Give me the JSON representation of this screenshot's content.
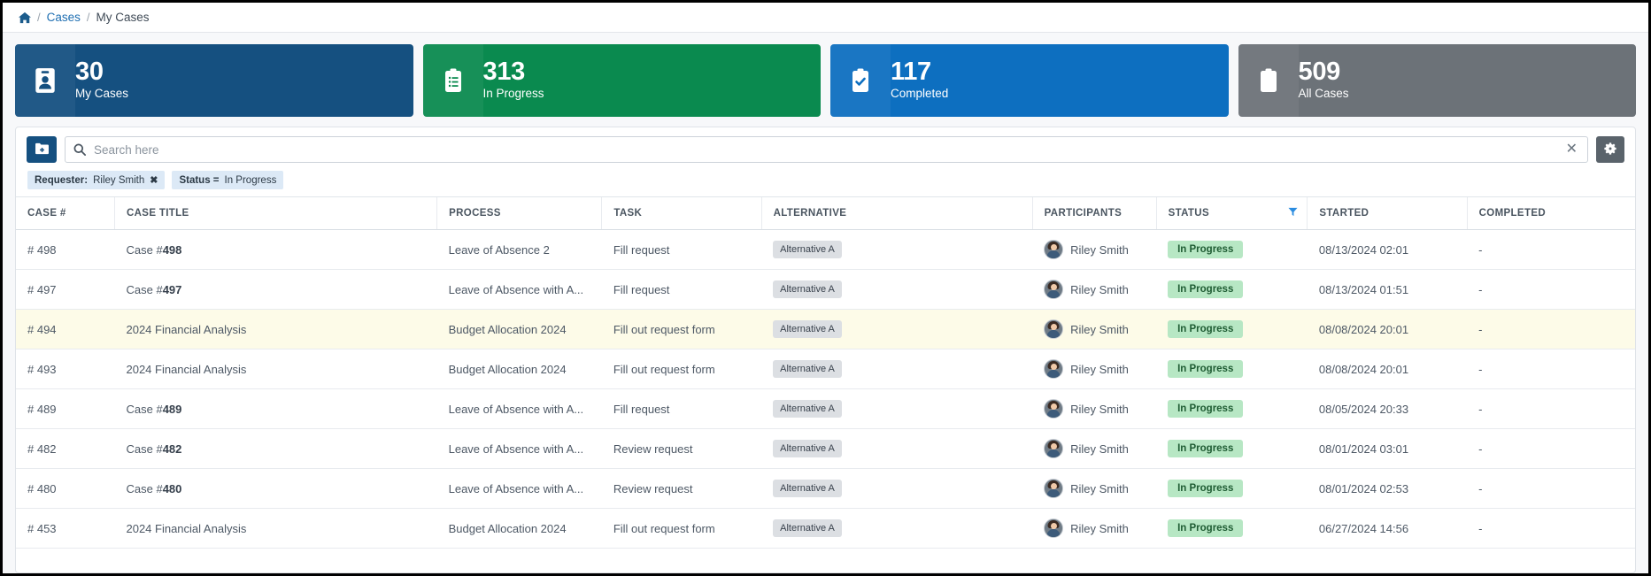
{
  "breadcrumb": {
    "home_icon": "home-icon",
    "separator": "/",
    "items": [
      {
        "label": "Cases",
        "link": true
      },
      {
        "label": "My Cases",
        "link": false
      }
    ]
  },
  "stat_cards": [
    {
      "value": "30",
      "label": "My Cases",
      "color": "#155080",
      "icon": "id-card-icon"
    },
    {
      "value": "313",
      "label": "In Progress",
      "color": "#0a8a4f",
      "icon": "clipboard-list-icon"
    },
    {
      "value": "117",
      "label": "Completed",
      "color": "#0d6fc0",
      "icon": "clipboard-check-icon"
    },
    {
      "value": "509",
      "label": "All Cases",
      "color": "#6c7278",
      "icon": "clipboard-icon"
    }
  ],
  "toolbar": {
    "folder_button_icon": "folder-plus-icon",
    "search_icon": "search-icon",
    "search_value": "",
    "search_placeholder": "Search here",
    "clear_icon": "close-icon",
    "clear_symbol": "✕",
    "settings_button_icon": "gear-icon"
  },
  "filters": [
    {
      "key": "Requester:",
      "value": "Riley Smith",
      "removable": true,
      "remove_symbol": "✖"
    },
    {
      "key": "Status =",
      "value": "In Progress",
      "removable": false,
      "remove_symbol": ""
    }
  ],
  "table": {
    "columns": [
      {
        "label": "CASE #",
        "sorted": false,
        "filter_icon": ""
      },
      {
        "label": "CASE TITLE",
        "sorted": false,
        "filter_icon": ""
      },
      {
        "label": "PROCESS",
        "sorted": false,
        "filter_icon": ""
      },
      {
        "label": "TASK",
        "sorted": false,
        "filter_icon": ""
      },
      {
        "label": "ALTERNATIVE",
        "sorted": false,
        "filter_icon": ""
      },
      {
        "label": "PARTICIPANTS",
        "sorted": false,
        "filter_icon": ""
      },
      {
        "label": "STATUS",
        "sorted": true,
        "filter_icon": "filter-funnel-icon"
      },
      {
        "label": "STARTED",
        "sorted": false,
        "filter_icon": ""
      },
      {
        "label": "COMPLETED",
        "sorted": false,
        "filter_icon": ""
      }
    ],
    "rows": [
      {
        "case_number": "# 498",
        "title_prefix": "Case #",
        "title_bold": "498",
        "process": "Leave of Absence 2",
        "task": "Fill request",
        "alternative": "Alternative A",
        "participant": "Riley Smith",
        "status": "In Progress",
        "started": "08/13/2024 02:01",
        "completed": "-",
        "highlight": false
      },
      {
        "case_number": "# 497",
        "title_prefix": "Case #",
        "title_bold": "497",
        "process": "Leave of Absence with A...",
        "task": "Fill request",
        "alternative": "Alternative A",
        "participant": "Riley Smith",
        "status": "In Progress",
        "started": "08/13/2024 01:51",
        "completed": "-",
        "highlight": false
      },
      {
        "case_number": "# 494",
        "title_prefix": "2024 Financial Analysis",
        "title_bold": "",
        "process": "Budget Allocation 2024",
        "task": "Fill out request form",
        "alternative": "Alternative A",
        "participant": "Riley Smith",
        "status": "In Progress",
        "started": "08/08/2024 20:01",
        "completed": "-",
        "highlight": true
      },
      {
        "case_number": "# 493",
        "title_prefix": "2024 Financial Analysis",
        "title_bold": "",
        "process": "Budget Allocation 2024",
        "task": "Fill out request form",
        "alternative": "Alternative A",
        "participant": "Riley Smith",
        "status": "In Progress",
        "started": "08/08/2024 20:01",
        "completed": "-",
        "highlight": false
      },
      {
        "case_number": "# 489",
        "title_prefix": "Case #",
        "title_bold": "489",
        "process": "Leave of Absence with A...",
        "task": "Fill request",
        "alternative": "Alternative A",
        "participant": "Riley Smith",
        "status": "In Progress",
        "started": "08/05/2024 20:33",
        "completed": "-",
        "highlight": false
      },
      {
        "case_number": "# 482",
        "title_prefix": "Case #",
        "title_bold": "482",
        "process": "Leave of Absence with A...",
        "task": "Review request",
        "alternative": "Alternative A",
        "participant": "Riley Smith",
        "status": "In Progress",
        "started": "08/01/2024 03:01",
        "completed": "-",
        "highlight": false
      },
      {
        "case_number": "# 480",
        "title_prefix": "Case #",
        "title_bold": "480",
        "process": "Leave of Absence with A...",
        "task": "Review request",
        "alternative": "Alternative A",
        "participant": "Riley Smith",
        "status": "In Progress",
        "started": "08/01/2024 02:53",
        "completed": "-",
        "highlight": false
      },
      {
        "case_number": "# 453",
        "title_prefix": "2024 Financial Analysis",
        "title_bold": "",
        "process": "Budget Allocation 2024",
        "task": "Fill out request form",
        "alternative": "Alternative A",
        "participant": "Riley Smith",
        "status": "In Progress",
        "started": "06/27/2024 14:56",
        "completed": "-",
        "highlight": false
      }
    ]
  }
}
